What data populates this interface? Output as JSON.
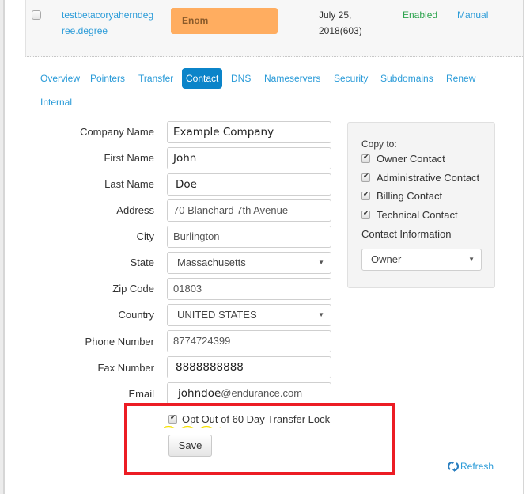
{
  "domain_row": {
    "domain_name": "testbetacoryaherndegree.degree",
    "registrar": "Enom",
    "expiry": "July 25, 2018(603)",
    "status": "Enabled",
    "renewal": "Manual"
  },
  "tabs": [
    {
      "label": "Overview",
      "active": false
    },
    {
      "label": "Pointers",
      "active": false
    },
    {
      "label": "Transfer",
      "active": false
    },
    {
      "label": "Contact",
      "active": true
    },
    {
      "label": "DNS",
      "active": false
    },
    {
      "label": "Nameservers",
      "active": false
    },
    {
      "label": "Security",
      "active": false
    },
    {
      "label": "Subdomains",
      "active": false
    },
    {
      "label": "Renew",
      "active": false
    },
    {
      "label": "Internal",
      "active": false
    }
  ],
  "form": {
    "company_name": {
      "label": "Company Name",
      "value": "Example Company"
    },
    "first_name": {
      "label": "First Name",
      "value": "John"
    },
    "last_name": {
      "label": "Last Name",
      "value": "Doe"
    },
    "address": {
      "label": "Address",
      "value": "70 Blanchard 7th Avenue"
    },
    "city": {
      "label": "City",
      "value": "Burlington"
    },
    "state": {
      "label": "State",
      "value": "Massachusetts"
    },
    "zip": {
      "label": "Zip Code",
      "value": "01803"
    },
    "country": {
      "label": "Country",
      "value": "UNITED STATES"
    },
    "phone": {
      "label": "Phone Number",
      "value": "8774724399"
    },
    "fax": {
      "label": "Fax Number",
      "value": "8888888888"
    },
    "email": {
      "label": "Email",
      "value_local": "johndoe",
      "value_domain": "@endurance.com"
    }
  },
  "copy_panel": {
    "title": "Copy to:",
    "items": [
      {
        "label": "Owner Contact",
        "checked": true
      },
      {
        "label": "Administrative Contact",
        "checked": true
      },
      {
        "label": "Billing Contact",
        "checked": true
      },
      {
        "label": "Technical Contact",
        "checked": true
      }
    ],
    "contact_info_label": "Contact Information",
    "contact_info_value": "Owner"
  },
  "opt_out": {
    "label": "Opt Out of 60 Day Transfer Lock",
    "checked": true
  },
  "save_label": "Save",
  "refresh_label": "Refresh",
  "colors": {
    "link": "#2a9bd8",
    "active_tab": "#0b84c9",
    "registrar_badge": "#ffad60",
    "status_enabled": "#2ea44f",
    "highlight": "#ec1c24"
  }
}
